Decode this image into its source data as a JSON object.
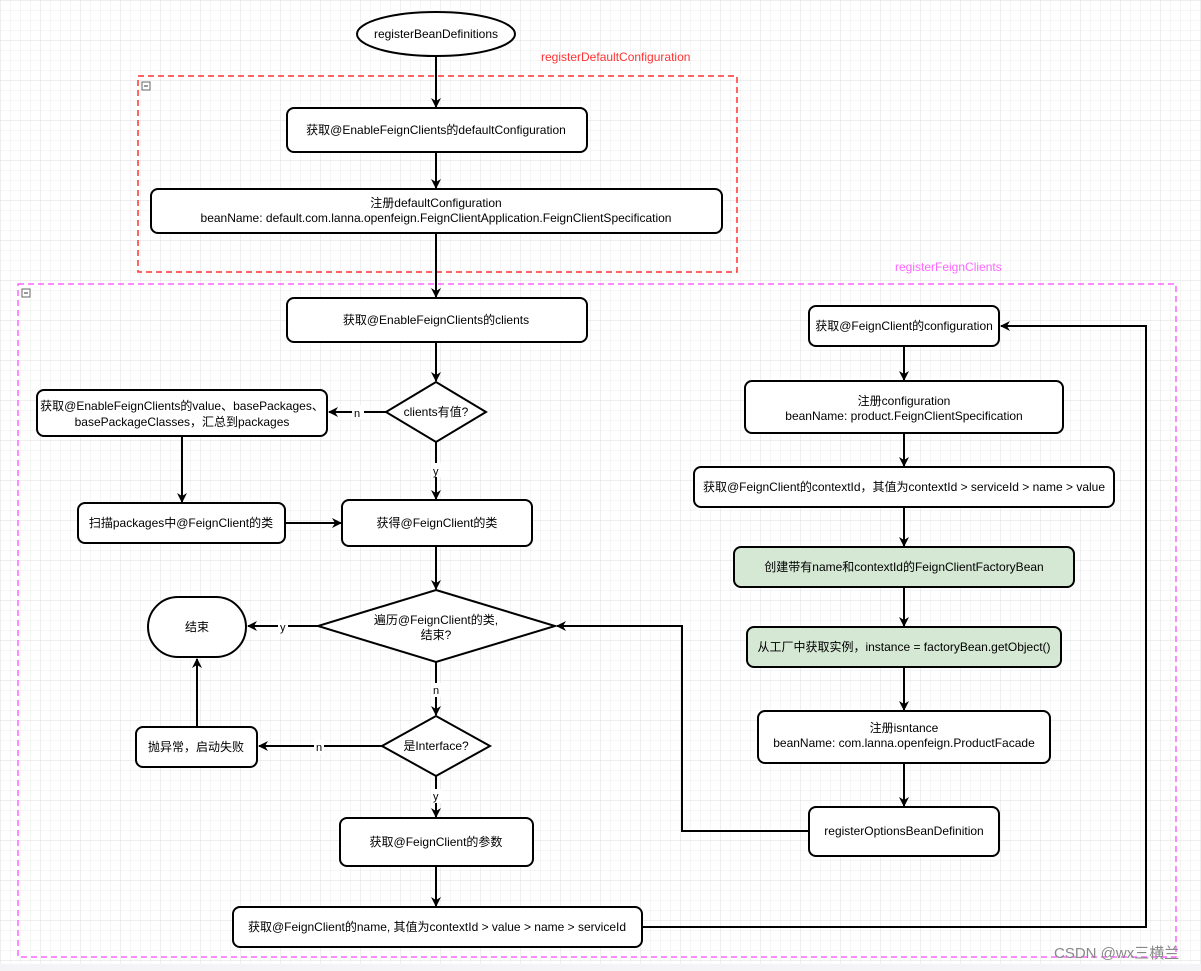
{
  "colors": {
    "default_group": "#ff3333",
    "clients_group": "#ff66ff",
    "highlight_fill": "#d5e8d4",
    "grid": "#e6e6e6"
  },
  "start": "registerBeanDefinitions",
  "groups": {
    "default_config": "registerDefaultConfiguration",
    "feign_clients": "registerFeignClients"
  },
  "nodes": {
    "get_default_config": "获取@EnableFeignClients的defaultConfiguration",
    "register_default_1": "注册defaultConfiguration",
    "register_default_2": "beanName: default.com.lanna.openfeign.FeignClientApplication.FeignClientSpecification",
    "get_clients": "获取@EnableFeignClients的clients",
    "clients_has_value": "clients有值?",
    "collect_packages_1": "获取@EnableFeignClients的value、basePackages、",
    "collect_packages_2": "basePackageClasses，汇总到packages",
    "scan_packages": "扫描packages中@FeignClient的类",
    "get_feign_class": "获得@FeignClient的类",
    "iterate_1": "遍历@FeignClient的类,",
    "iterate_2": "结束?",
    "end": "结束",
    "is_interface": "是Interface?",
    "throw": "抛异常，启动失败",
    "get_params": "获取@FeignClient的参数",
    "get_name": "获取@FeignClient的name, 其值为contextId > value > name > serviceId",
    "get_config": "获取@FeignClient的configuration",
    "register_config_1": "注册configuration",
    "register_config_2": "beanName: product.FeignClientSpecification",
    "get_context_id": "获取@FeignClient的contextId，其值为contextId >  serviceId > name > value",
    "create_factory": "创建带有name和contextId的FeignClientFactoryBean",
    "get_instance": "从工厂中获取实例，instance = factoryBean.getObject()",
    "register_instance_1": "注册isntance",
    "register_instance_2": "beanName: com.lanna.openfeign.ProductFacade",
    "register_options": "registerOptionsBeanDefinition"
  },
  "edge_labels": {
    "n": "n",
    "y": "y"
  },
  "watermark": "CSDN @wx三横兰"
}
